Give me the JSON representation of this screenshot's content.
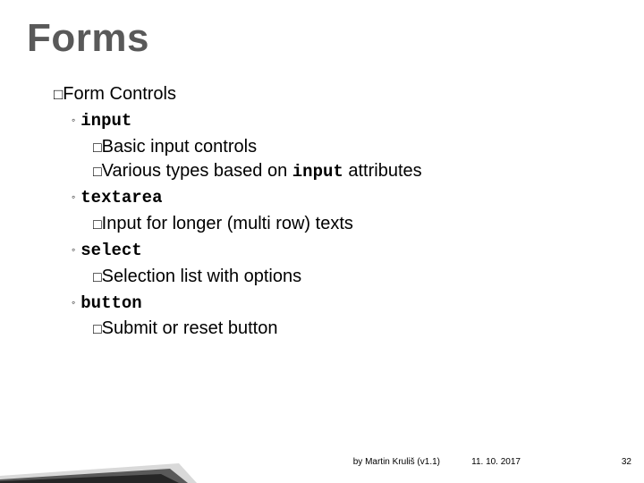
{
  "title": "Forms",
  "section": {
    "bullet": "□",
    "prefix": "Form",
    "rest": " Controls"
  },
  "items": [
    {
      "tag": "input",
      "subs": [
        {
          "bullet": "□",
          "text": "Basic input controls"
        },
        {
          "bullet": "□",
          "pre": "Various types based on ",
          "code": "input",
          "post": " attributes"
        }
      ]
    },
    {
      "tag": "textarea",
      "subs": [
        {
          "bullet": "□",
          "text": "Input for longer (multi row) texts"
        }
      ]
    },
    {
      "tag": "select",
      "subs": [
        {
          "bullet": "□",
          "text": "Selection list with options"
        }
      ]
    },
    {
      "tag": "button",
      "subs": [
        {
          "bullet": "□",
          "text": "Submit or reset button"
        }
      ]
    }
  ],
  "diamond": "◦",
  "footer": {
    "byline": "by Martin Kruliš (v1.1)",
    "date": "11. 10. 2017",
    "page": "32"
  }
}
